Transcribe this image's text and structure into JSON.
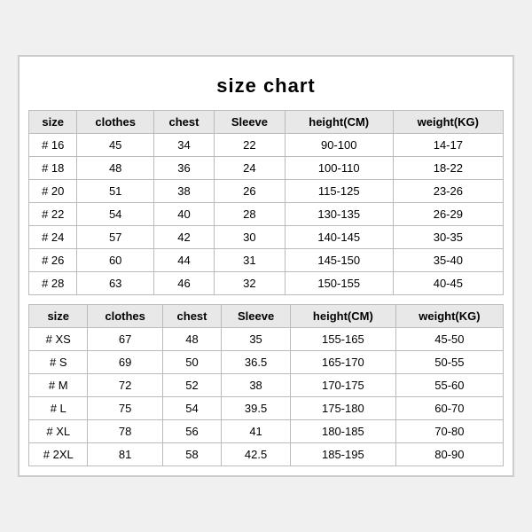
{
  "title": "size chart",
  "tables": [
    {
      "headers": [
        "size",
        "clothes",
        "chest",
        "Sleeve",
        "height(CM)",
        "weight(KG)"
      ],
      "rows": [
        [
          "# 16",
          "45",
          "34",
          "22",
          "90-100",
          "14-17"
        ],
        [
          "# 18",
          "48",
          "36",
          "24",
          "100-110",
          "18-22"
        ],
        [
          "# 20",
          "51",
          "38",
          "26",
          "115-125",
          "23-26"
        ],
        [
          "# 22",
          "54",
          "40",
          "28",
          "130-135",
          "26-29"
        ],
        [
          "# 24",
          "57",
          "42",
          "30",
          "140-145",
          "30-35"
        ],
        [
          "# 26",
          "60",
          "44",
          "31",
          "145-150",
          "35-40"
        ],
        [
          "# 28",
          "63",
          "46",
          "32",
          "150-155",
          "40-45"
        ]
      ]
    },
    {
      "headers": [
        "size",
        "clothes",
        "chest",
        "Sleeve",
        "height(CM)",
        "weight(KG)"
      ],
      "rows": [
        [
          "# XS",
          "67",
          "48",
          "35",
          "155-165",
          "45-50"
        ],
        [
          "# S",
          "69",
          "50",
          "36.5",
          "165-170",
          "50-55"
        ],
        [
          "# M",
          "72",
          "52",
          "38",
          "170-175",
          "55-60"
        ],
        [
          "# L",
          "75",
          "54",
          "39.5",
          "175-180",
          "60-70"
        ],
        [
          "# XL",
          "78",
          "56",
          "41",
          "180-185",
          "70-80"
        ],
        [
          "# 2XL",
          "81",
          "58",
          "42.5",
          "185-195",
          "80-90"
        ]
      ]
    }
  ]
}
